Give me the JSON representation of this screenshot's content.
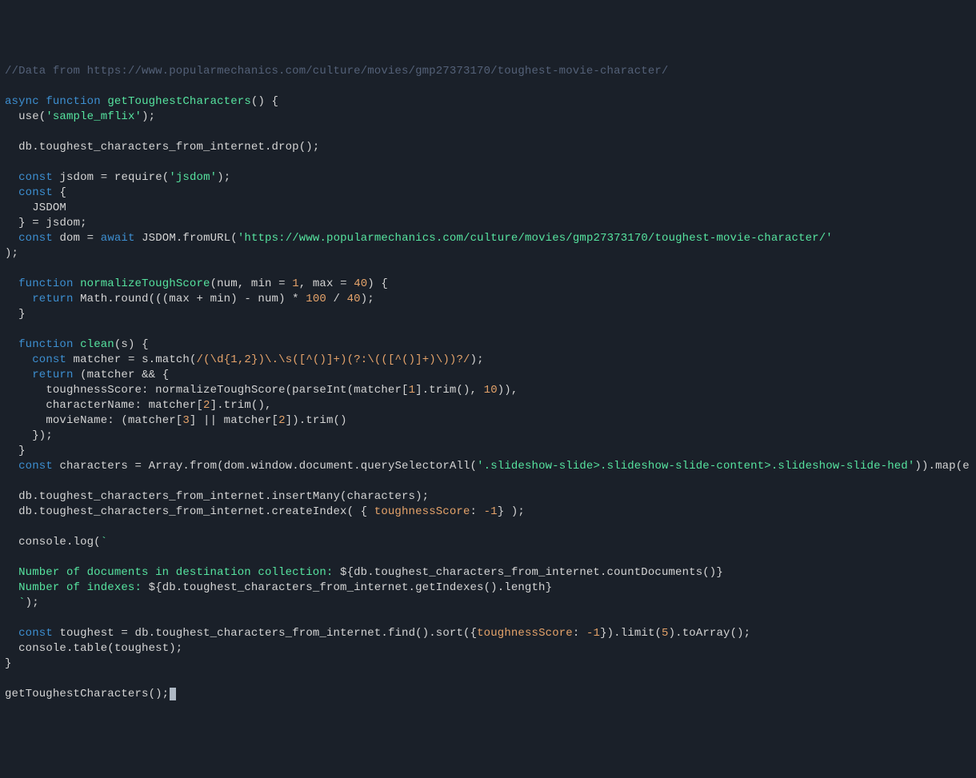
{
  "code": {
    "comment": "//Data from https://www.popularmechanics.com/culture/movies/gmp27373170/toughest-movie-character/",
    "fn_main": "getToughestCharacters",
    "use_arg": "'sample_mflix'",
    "drop_call": "db.toughest_characters_from_internet.drop();",
    "require_arg": "'jsdom'",
    "destruct_name": "JSDOM",
    "from_url_arg": "'https://www.popularmechanics.com/culture/movies/gmp27373170/toughest-movie-character/'",
    "fn_norm": "normalizeToughScore",
    "norm_params": "(num, min = ",
    "norm_min": "1",
    "norm_mid": ", max = ",
    "norm_max": "40",
    "norm_body1": "Math.round(((max + min) - num) * ",
    "norm_100": "100",
    "norm_slash": " / ",
    "norm_40": "40",
    "fn_clean": "clean",
    "regex": "/(\\d{1,2})\\.\\s([^()]+)(?:\\(([^()]+)\\))?/",
    "clean_key1": "toughnessScore",
    "clean_val1a": "normalizeToughScore(parseInt(matcher[",
    "idx1": "1",
    "clean_val1b": "].trim(), ",
    "ten": "10",
    "clean_key2": "characterName",
    "clean_val2a": "matcher[",
    "idx2": "2",
    "clean_val2b": "].trim(),",
    "clean_key3": "movieName",
    "clean_val3a": "(matcher[",
    "idx3": "3",
    "clean_val3b": "] || matcher[",
    "idx2b": "2",
    "clean_val3c": "]).trim()",
    "selector": "'.slideshow-slide>.slideshow-slide-content>.slideshow-slide-hed'",
    "map_body": ".map(e => clean(e.textContent.trim()));",
    "insert": "db.toughest_characters_from_internet.insertMany(characters);",
    "createIndex_pre": "db.toughest_characters_from_internet.createIndex( { ",
    "ci_key": "toughnessScore",
    "ci_val": "-1",
    "createIndex_post": "} );",
    "tpl_line1": "  Number of documents in destination collection: ",
    "tpl_inter1": "${db.toughest_characters_from_internet.countDocuments()}",
    "tpl_line2": "  Number of indexes: ",
    "tpl_inter2": "${db.toughest_characters_from_internet.getIndexes().length}",
    "find_pre": "db.toughest_characters_from_internet.find().sort({",
    "find_key": "toughnessScore",
    "find_val": "-1",
    "find_mid": "}).limit(",
    "limit5": "5",
    "find_post": ").toArray();",
    "table_call": "console.table(toughest);",
    "final_call": "getToughestCharacters();"
  }
}
